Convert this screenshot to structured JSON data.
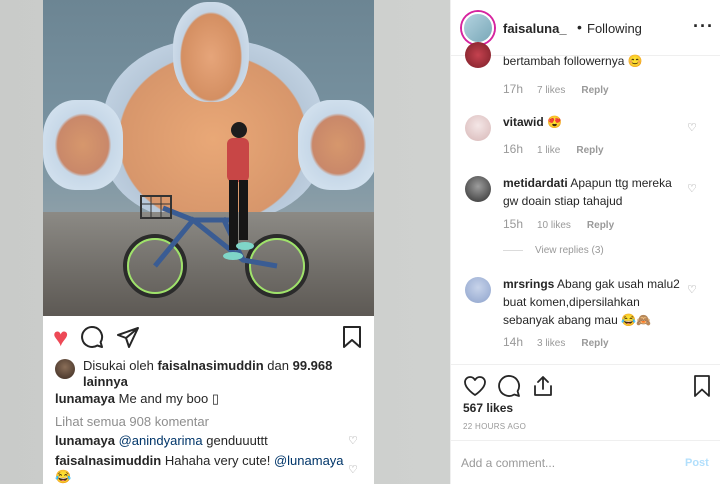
{
  "left_post": {
    "liked_by_prefix": "Disukai oleh",
    "liked_by_user": "faisalnasimuddin",
    "liked_by_and": "dan",
    "liked_by_count": "99.968",
    "liked_by_suffix": "lainnya",
    "caption_user": "lunamaya",
    "caption_text": "Me and my boo ▯",
    "view_all_comments": "Lihat semua 908 komentar",
    "comment1_user": "lunamaya",
    "comment1_mention": "@anindyarima",
    "comment1_text": "genduuuttt",
    "comment2_user": "faisalnasimuddin",
    "comment2_text": "Hahaha very cute!",
    "comment2_mention": "@lunamaya",
    "comment2_emoji": "😂"
  },
  "header": {
    "username": "faisaluna_",
    "dot": "•",
    "follow_status": "Following",
    "more": "···"
  },
  "comments": [
    {
      "user": "",
      "text": "bertambah followernya 😊",
      "time": "17h",
      "likes": "7 likes",
      "reply": "Reply"
    },
    {
      "user": "vitawid",
      "text": "😍",
      "time": "16h",
      "likes": "1 like",
      "reply": "Reply"
    },
    {
      "user": "metidardati",
      "text": "Apapun ttg mereka gw doain stiap tahajud",
      "time": "15h",
      "likes": "10 likes",
      "reply": "Reply",
      "view_replies": "View replies (3)"
    },
    {
      "user": "mrsrings",
      "text": "Abang gak usah malu2 buat komen,dipersilahkan sebanyak abang mau 😂🙈",
      "time": "14h",
      "likes": "3 likes",
      "reply": "Reply"
    }
  ],
  "footer": {
    "likes": "567 likes",
    "post_time": "22 HOURS AGO",
    "comment_placeholder": "Add a comment...",
    "post_button": "Post"
  },
  "icons": {
    "heart_filled": "heart-icon",
    "comment": "comment-icon",
    "share": "share-icon",
    "upload": "upload-icon",
    "bookmark": "bookmark-icon"
  },
  "colors": {
    "like_red": "#ed4956",
    "link_blue": "#003569",
    "post_blue_disabled": "#b2dffc",
    "muted": "#999999"
  }
}
